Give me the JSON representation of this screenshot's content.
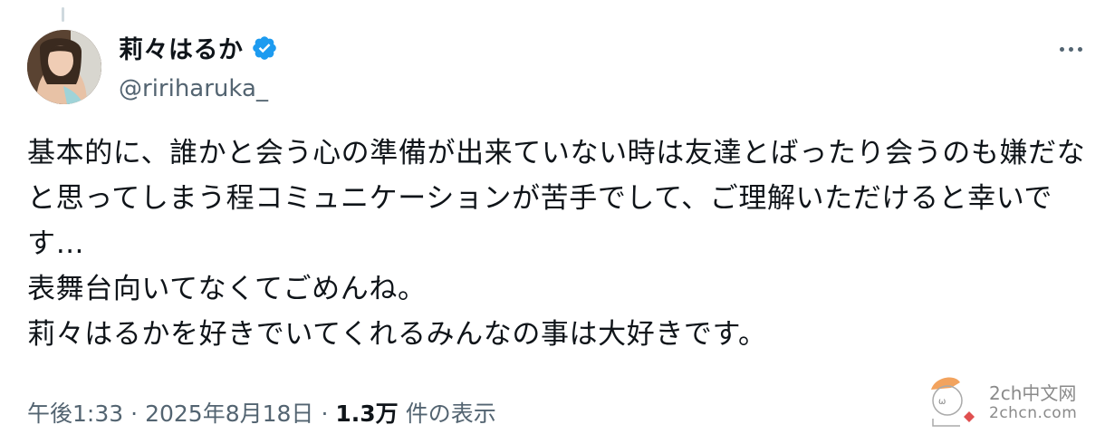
{
  "user": {
    "display_name": "莉々はるか",
    "handle": "@ririharuka_"
  },
  "icons": {
    "verified": "verified-badge-icon",
    "more": "more-options-icon"
  },
  "colors": {
    "verified": "#1d9bf0",
    "secondary_text": "#536471",
    "primary_text": "#0f1419"
  },
  "tweet": {
    "text": "基本的に、誰かと会う心の準備が出来ていない時は友達とばったり会うのも嫌だなと思ってしまう程コミュニケーションが苦手でして、ご理解いただけると幸いです…\n表舞台向いてなくてごめんね。\n莉々はるかを好きでいてくれるみんなの事は大好きです。"
  },
  "meta": {
    "time": "午後1:33",
    "sep1": "·",
    "date": "2025年8月18日",
    "sep2": "·",
    "views": "1.3万",
    "views_label": "件の表示"
  },
  "watermark": {
    "line1": "2ch中文网",
    "line2": "2chcn.com"
  }
}
